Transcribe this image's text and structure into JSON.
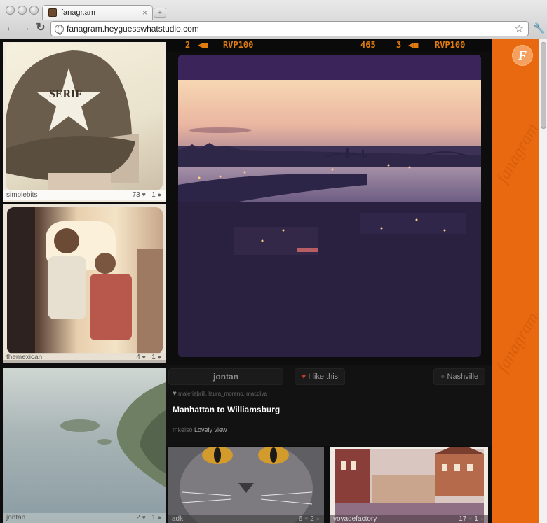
{
  "browser": {
    "tab_title": "fanagr.am",
    "new_tab_label": "+",
    "tab_close_label": "×",
    "back_label": "←",
    "forward_label": "→",
    "reload_label": "↻",
    "url": "fanagram.heyguesswhatstudio.com",
    "bookmark_label": "☆",
    "menu_label": "🔧"
  },
  "film_header": {
    "frame_left": "2",
    "code_left": "RVP100",
    "number": "465",
    "frame_right": "3",
    "code_right": "RVP100"
  },
  "left_tiles": [
    {
      "user": "simplebits",
      "likes": "73",
      "comments": "1"
    },
    {
      "user": "themexican",
      "likes": "4",
      "comments": "1"
    },
    {
      "user": "jontan",
      "likes": "2",
      "comments": "1"
    }
  ],
  "post": {
    "user": "jontan",
    "like_label": "I like this",
    "location": "Nashville",
    "likers": "malerieb­rill, laura_moreno, macdiva",
    "caption": "Manhattan to Williamsburg",
    "comment_user": "mkelso",
    "comment_text": "Lovely view"
  },
  "bottom_tiles": [
    {
      "user": "adk",
      "likes": "6",
      "comments": "2"
    },
    {
      "user": "voyagefactory",
      "likes": "17",
      "comments": "1"
    }
  ],
  "sidebar": {
    "logo_letter": "F",
    "watermark": "fanagram"
  },
  "colors": {
    "accent_orange": "#e8690f",
    "film_text": "#e07b10",
    "card_purple": "#3b2459"
  }
}
